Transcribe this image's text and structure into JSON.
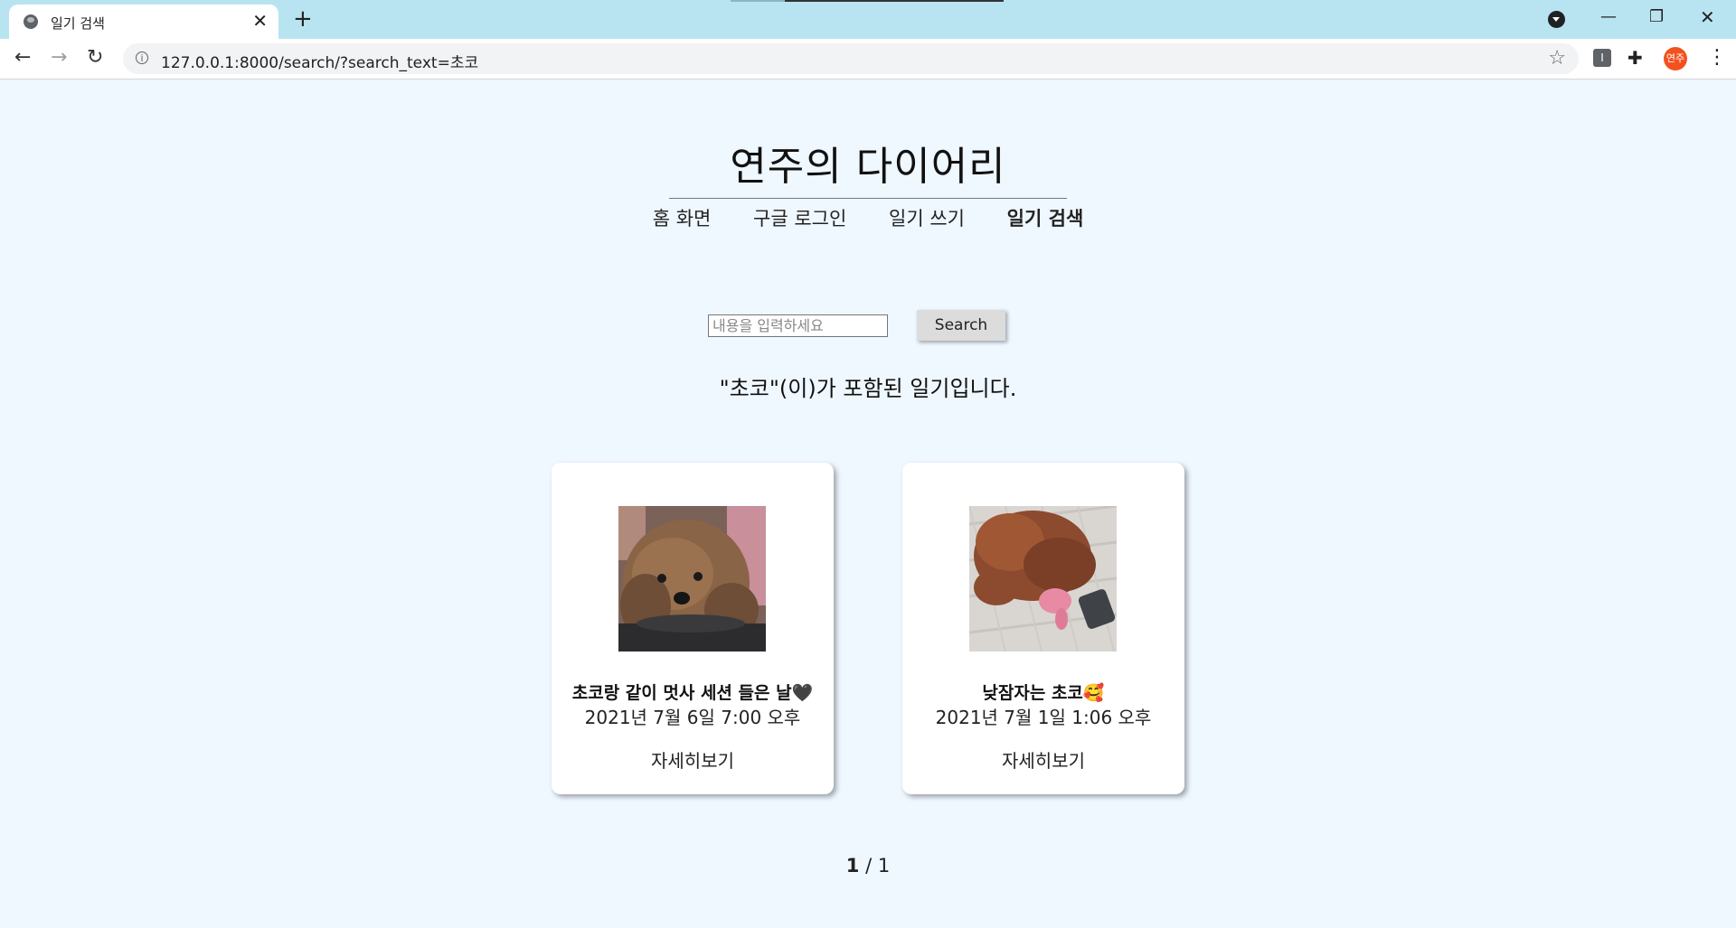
{
  "browser": {
    "tab_title": "일기 검색",
    "tab_close": "✕",
    "new_tab": "+",
    "url": "127.0.0.1:8000/search/?search_text=초코",
    "avatar_text": "연주",
    "window_controls": {
      "minimize": "—",
      "maximize": "❐",
      "close": "✕"
    },
    "icons": [
      "globe-icon",
      "back-arrow-icon",
      "forward-arrow-icon",
      "reload-icon",
      "info-icon",
      "star-icon",
      "extension-icon",
      "puzzle-icon",
      "kebab-menu-icon"
    ]
  },
  "site": {
    "title": "연주의 다이어리",
    "nav": [
      "홈 화면",
      "구글 로그인",
      "일기 쓰기",
      "일기 검색"
    ]
  },
  "search": {
    "placeholder": "내용을 입력하세요",
    "button_label": "Search",
    "result_heading": "\"초코\"(이)가 포함된 일기입니다."
  },
  "results": [
    {
      "title": "초코랑 같이 멋사 세션 들은 날🖤",
      "date": "2021년 7월 6일 7:00 오후",
      "link": "자세히보기"
    },
    {
      "title": "낮잠자는 초코🥰",
      "date": "2021년 7월 1일 1:06 오후",
      "link": "자세히보기"
    }
  ],
  "pagination": {
    "current": "1",
    "separator": "/",
    "total": "1"
  },
  "colors": {
    "tabbar": "#b8e4f2",
    "page_background": "#eff7ff",
    "avatar": "#f4511e"
  }
}
